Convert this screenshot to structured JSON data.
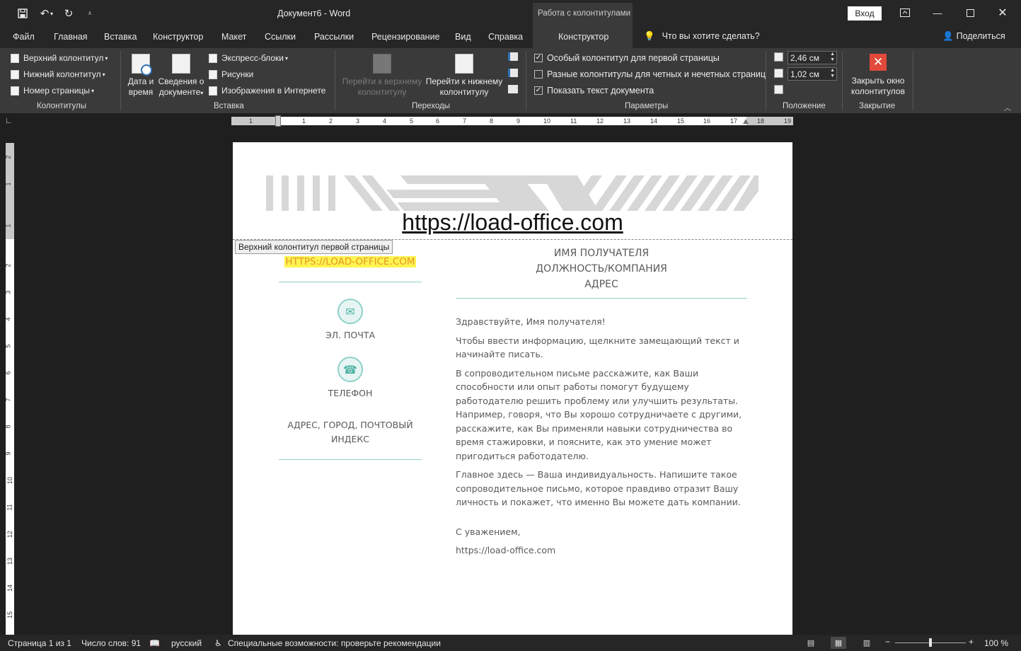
{
  "titlebar": {
    "doc_title": "Документ6  -  Word",
    "context_group": "Работа с колонтитулами",
    "signin": "Вход"
  },
  "tabs": [
    "Файл",
    "Главная",
    "Вставка",
    "Конструктор",
    "Макет",
    "Ссылки",
    "Рассылки",
    "Рецензирование",
    "Вид",
    "Справка"
  ],
  "active_tab": "Конструктор",
  "tell_me": "Что вы хотите сделать?",
  "share": "Поделиться",
  "ribbon": {
    "hf": {
      "header": "Верхний колонтитул",
      "footer": "Нижний колонтитул",
      "pagenum": "Номер страницы",
      "label": "Колонтитулы"
    },
    "insert": {
      "date_time_1": "Дата и",
      "date_time_2": "время",
      "docinfo_1": "Сведения о",
      "docinfo_2": "документе",
      "quickparts": "Экспресс-блоки",
      "pictures": "Рисунки",
      "online_pictures": "Изображения в Интернете",
      "label": "Вставка"
    },
    "nav": {
      "goto_header_1": "Перейти к верхнему",
      "goto_header_2": "колонтитулу",
      "goto_footer_1": "Перейти к нижнему",
      "goto_footer_2": "колонтитулу",
      "label": "Переходы"
    },
    "options": {
      "first_page": "Особый колонтитул для первой страницы",
      "odd_even": "Разные колонтитулы для четных и нечетных страниц",
      "show_text": "Показать текст документа",
      "first_page_checked": true,
      "odd_even_checked": false,
      "show_text_checked": true,
      "label": "Параметры"
    },
    "position": {
      "header_pos": "2,46 см",
      "footer_pos": "1,02 см",
      "label": "Положение"
    },
    "close": {
      "btn_1": "Закрыть окно",
      "btn_2": "колонтитулов",
      "label": "Закрытие"
    }
  },
  "ruler": {
    "h_nums": [
      "1",
      "1",
      "2",
      "3",
      "4",
      "5",
      "6",
      "7",
      "8",
      "9",
      "10",
      "11",
      "12",
      "13",
      "14",
      "15",
      "16",
      "17",
      "18",
      "19"
    ],
    "v_nums": [
      "2",
      "1",
      "1",
      "2",
      "3",
      "4",
      "5",
      "6",
      "7",
      "8",
      "9",
      "10",
      "11",
      "12",
      "13",
      "14",
      "15"
    ]
  },
  "page": {
    "header_url": "https://load-office.com",
    "header_tag": "Верхний колонтитул первой страницы",
    "left": {
      "url": "HTTPS://LOAD-OFFICE.COM",
      "email": "ЭЛ. ПОЧТА",
      "phone": "ТЕЛЕФОН",
      "address": "АДРЕС, ГОРОД, ПОЧТОВЫЙ ИНДЕКС"
    },
    "right": {
      "rcpt_name": "ИМЯ ПОЛУЧАТЕЛЯ",
      "rcpt_title": "ДОЛЖНОСТЬ/КОМПАНИЯ",
      "rcpt_addr": "АДРЕС",
      "greeting": "Здравствуйте, Имя получателя!",
      "p1": "Чтобы ввести информацию, щелкните замещающий текст и начинайте писать.",
      "p2": "В сопроводительном письме расскажите, как Ваши способности или опыт работы помогут будущему работодателю решить проблему или улучшить результаты. Например, говоря, что Вы хорошо сотрудничаете с другими, расскажите, как Вы применяли навыки сотрудничества во время стажировки, и поясните, как это умение может пригодиться работодателю.",
      "p3": "Главное здесь — Ваша индивидуальность. Напишите такое сопроводительное письмо, которое правдиво отразит Вашу личность и покажет, что именно Вы можете дать компании.",
      "closing": "С уважением,",
      "signature": "https://load-office.com"
    }
  },
  "status": {
    "page": "Страница 1 из 1",
    "words": "Число слов: 91",
    "lang": "русский",
    "accessibility": "Специальные возможности: проверьте рекомендации",
    "zoom": "100 %",
    "zoom_level_percent": 100
  },
  "colors": {
    "accent_teal": "#8fd1c8",
    "highlight_yellow": "#fff44f",
    "url_orange": "#e5962a",
    "close_red": "#e1493a"
  }
}
